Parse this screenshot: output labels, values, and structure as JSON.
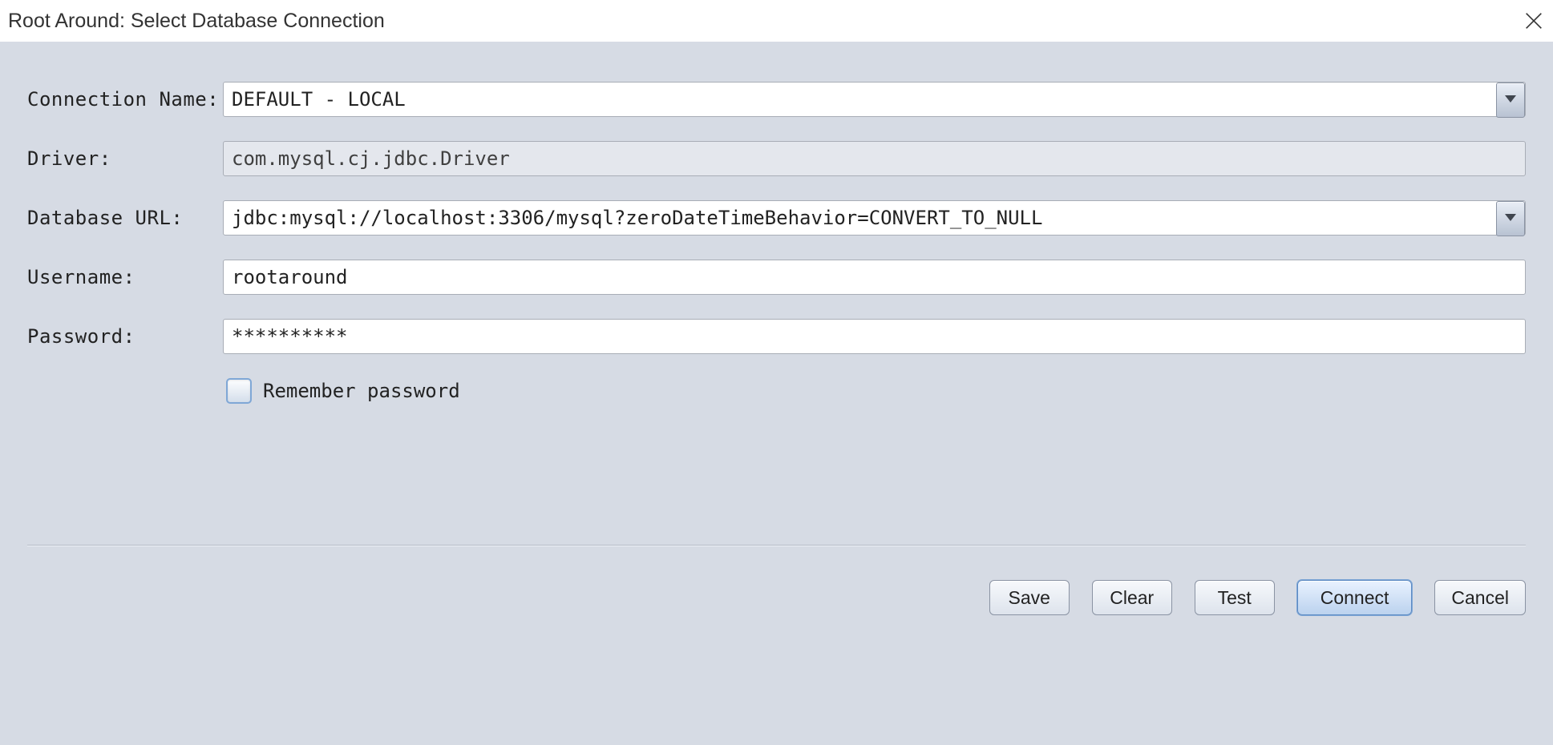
{
  "titlebar": {
    "title": "Root Around: Select Database Connection"
  },
  "form": {
    "connection_name": {
      "label": "Connection Name:",
      "value": "DEFAULT - LOCAL"
    },
    "driver": {
      "label": "Driver:",
      "value": "com.mysql.cj.jdbc.Driver"
    },
    "database_url": {
      "label": "Database URL:",
      "value": "jdbc:mysql://localhost:3306/mysql?zeroDateTimeBehavior=CONVERT_TO_NULL"
    },
    "username": {
      "label": "Username:",
      "value": "rootaround"
    },
    "password": {
      "label": "Password:",
      "value": "**********"
    },
    "remember": {
      "label": "Remember password",
      "checked": false
    }
  },
  "buttons": {
    "save": "Save",
    "clear": "Clear",
    "test": "Test",
    "connect": "Connect",
    "cancel": "Cancel"
  }
}
